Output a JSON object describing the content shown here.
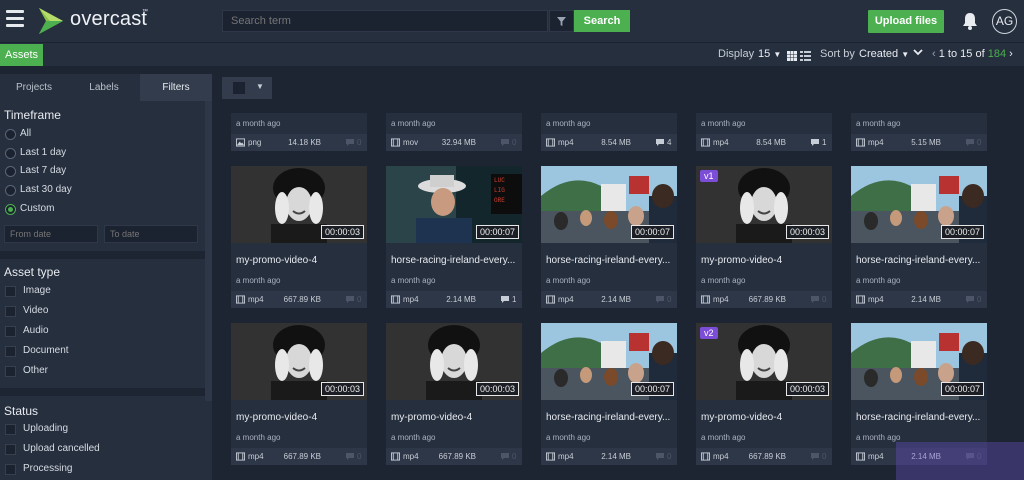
{
  "header": {
    "logo_text": "overcast",
    "logo_tm": "™",
    "search_placeholder": "Search term",
    "search_button": "Search",
    "upload_button": "Upload files",
    "avatar_initials": "AG"
  },
  "subbar": {
    "assets_tab": "Assets",
    "display_label": "Display",
    "display_value": "15",
    "sort_label": "Sort by",
    "sort_value": "Created",
    "pager_from": "1",
    "pager_to_word": "to",
    "pager_to": "15",
    "pager_of_word": "of",
    "pager_total": "184"
  },
  "sidebar": {
    "tabs": [
      "Projects",
      "Labels",
      "Filters"
    ],
    "active_tab": "Filters",
    "timeframe": {
      "title": "Timeframe",
      "options": [
        "All",
        "Last 1 day",
        "Last 7 day",
        "Last 30 day",
        "Custom"
      ],
      "selected": "Custom",
      "from_placeholder": "From date",
      "to_placeholder": "To date"
    },
    "asset_type": {
      "title": "Asset type",
      "options": [
        "Image",
        "Video",
        "Audio",
        "Document",
        "Other"
      ]
    },
    "status": {
      "title": "Status",
      "options": [
        "Uploading",
        "Upload cancelled",
        "Processing"
      ]
    }
  },
  "top_row": [
    {
      "age": "a month ago",
      "type": "png",
      "size": "14.18 KB",
      "comments": "0"
    },
    {
      "age": "a month ago",
      "type": "mov",
      "size": "32.94 MB",
      "comments": "0"
    },
    {
      "age": "a month ago",
      "type": "mp4",
      "size": "8.54 MB",
      "comments": "4"
    },
    {
      "age": "a month ago",
      "type": "mp4",
      "size": "8.54 MB",
      "comments": "1"
    },
    {
      "age": "a month ago",
      "type": "mp4",
      "size": "5.15 MB",
      "comments": "0"
    }
  ],
  "cards": [
    {
      "title": "my-promo-video-4",
      "age": "a month ago",
      "type": "mp4",
      "size": "667.89 KB",
      "comments": "0",
      "duration": "00:00:03",
      "version": "",
      "thumb": "woman"
    },
    {
      "title": "horse-racing-ireland-every...",
      "age": "a month ago",
      "type": "mp4",
      "size": "2.14 MB",
      "comments": "1",
      "duration": "00:00:07",
      "version": "",
      "thumb": "man"
    },
    {
      "title": "horse-racing-ireland-every...",
      "age": "a month ago",
      "type": "mp4",
      "size": "2.14 MB",
      "comments": "0",
      "duration": "00:00:07",
      "version": "",
      "thumb": "crowd"
    },
    {
      "title": "my-promo-video-4",
      "age": "a month ago",
      "type": "mp4",
      "size": "667.89 KB",
      "comments": "0",
      "duration": "00:00:03",
      "version": "v1",
      "thumb": "woman"
    },
    {
      "title": "horse-racing-ireland-every...",
      "age": "a month ago",
      "type": "mp4",
      "size": "2.14 MB",
      "comments": "0",
      "duration": "00:00:07",
      "version": "",
      "thumb": "crowd"
    },
    {
      "title": "my-promo-video-4",
      "age": "a month ago",
      "type": "mp4",
      "size": "667.89 KB",
      "comments": "0",
      "duration": "00:00:03",
      "version": "",
      "thumb": "woman"
    },
    {
      "title": "my-promo-video-4",
      "age": "a month ago",
      "type": "mp4",
      "size": "667.89 KB",
      "comments": "0",
      "duration": "00:00:03",
      "version": "",
      "thumb": "woman"
    },
    {
      "title": "horse-racing-ireland-every...",
      "age": "a month ago",
      "type": "mp4",
      "size": "2.14 MB",
      "comments": "0",
      "duration": "00:00:07",
      "version": "",
      "thumb": "crowd"
    },
    {
      "title": "my-promo-video-4",
      "age": "a month ago",
      "type": "mp4",
      "size": "667.89 KB",
      "comments": "0",
      "duration": "00:00:03",
      "version": "v2",
      "thumb": "woman"
    },
    {
      "title": "horse-racing-ireland-every...",
      "age": "a month ago",
      "type": "mp4",
      "size": "2.14 MB",
      "comments": "0",
      "duration": "00:00:07",
      "version": "",
      "thumb": "crowd"
    }
  ],
  "colors": {
    "accent": "#4caf50",
    "background": "#1e2532",
    "panel": "#262f3e",
    "version_badge": "#7c4dd6"
  },
  "icons": {
    "menu": "hamburger-icon",
    "filter": "funnel-icon",
    "notifications": "bell-icon",
    "grid_view": "grid-view-icon",
    "list_view": "list-view-icon",
    "comment": "comment-icon",
    "file": "film-icon"
  }
}
